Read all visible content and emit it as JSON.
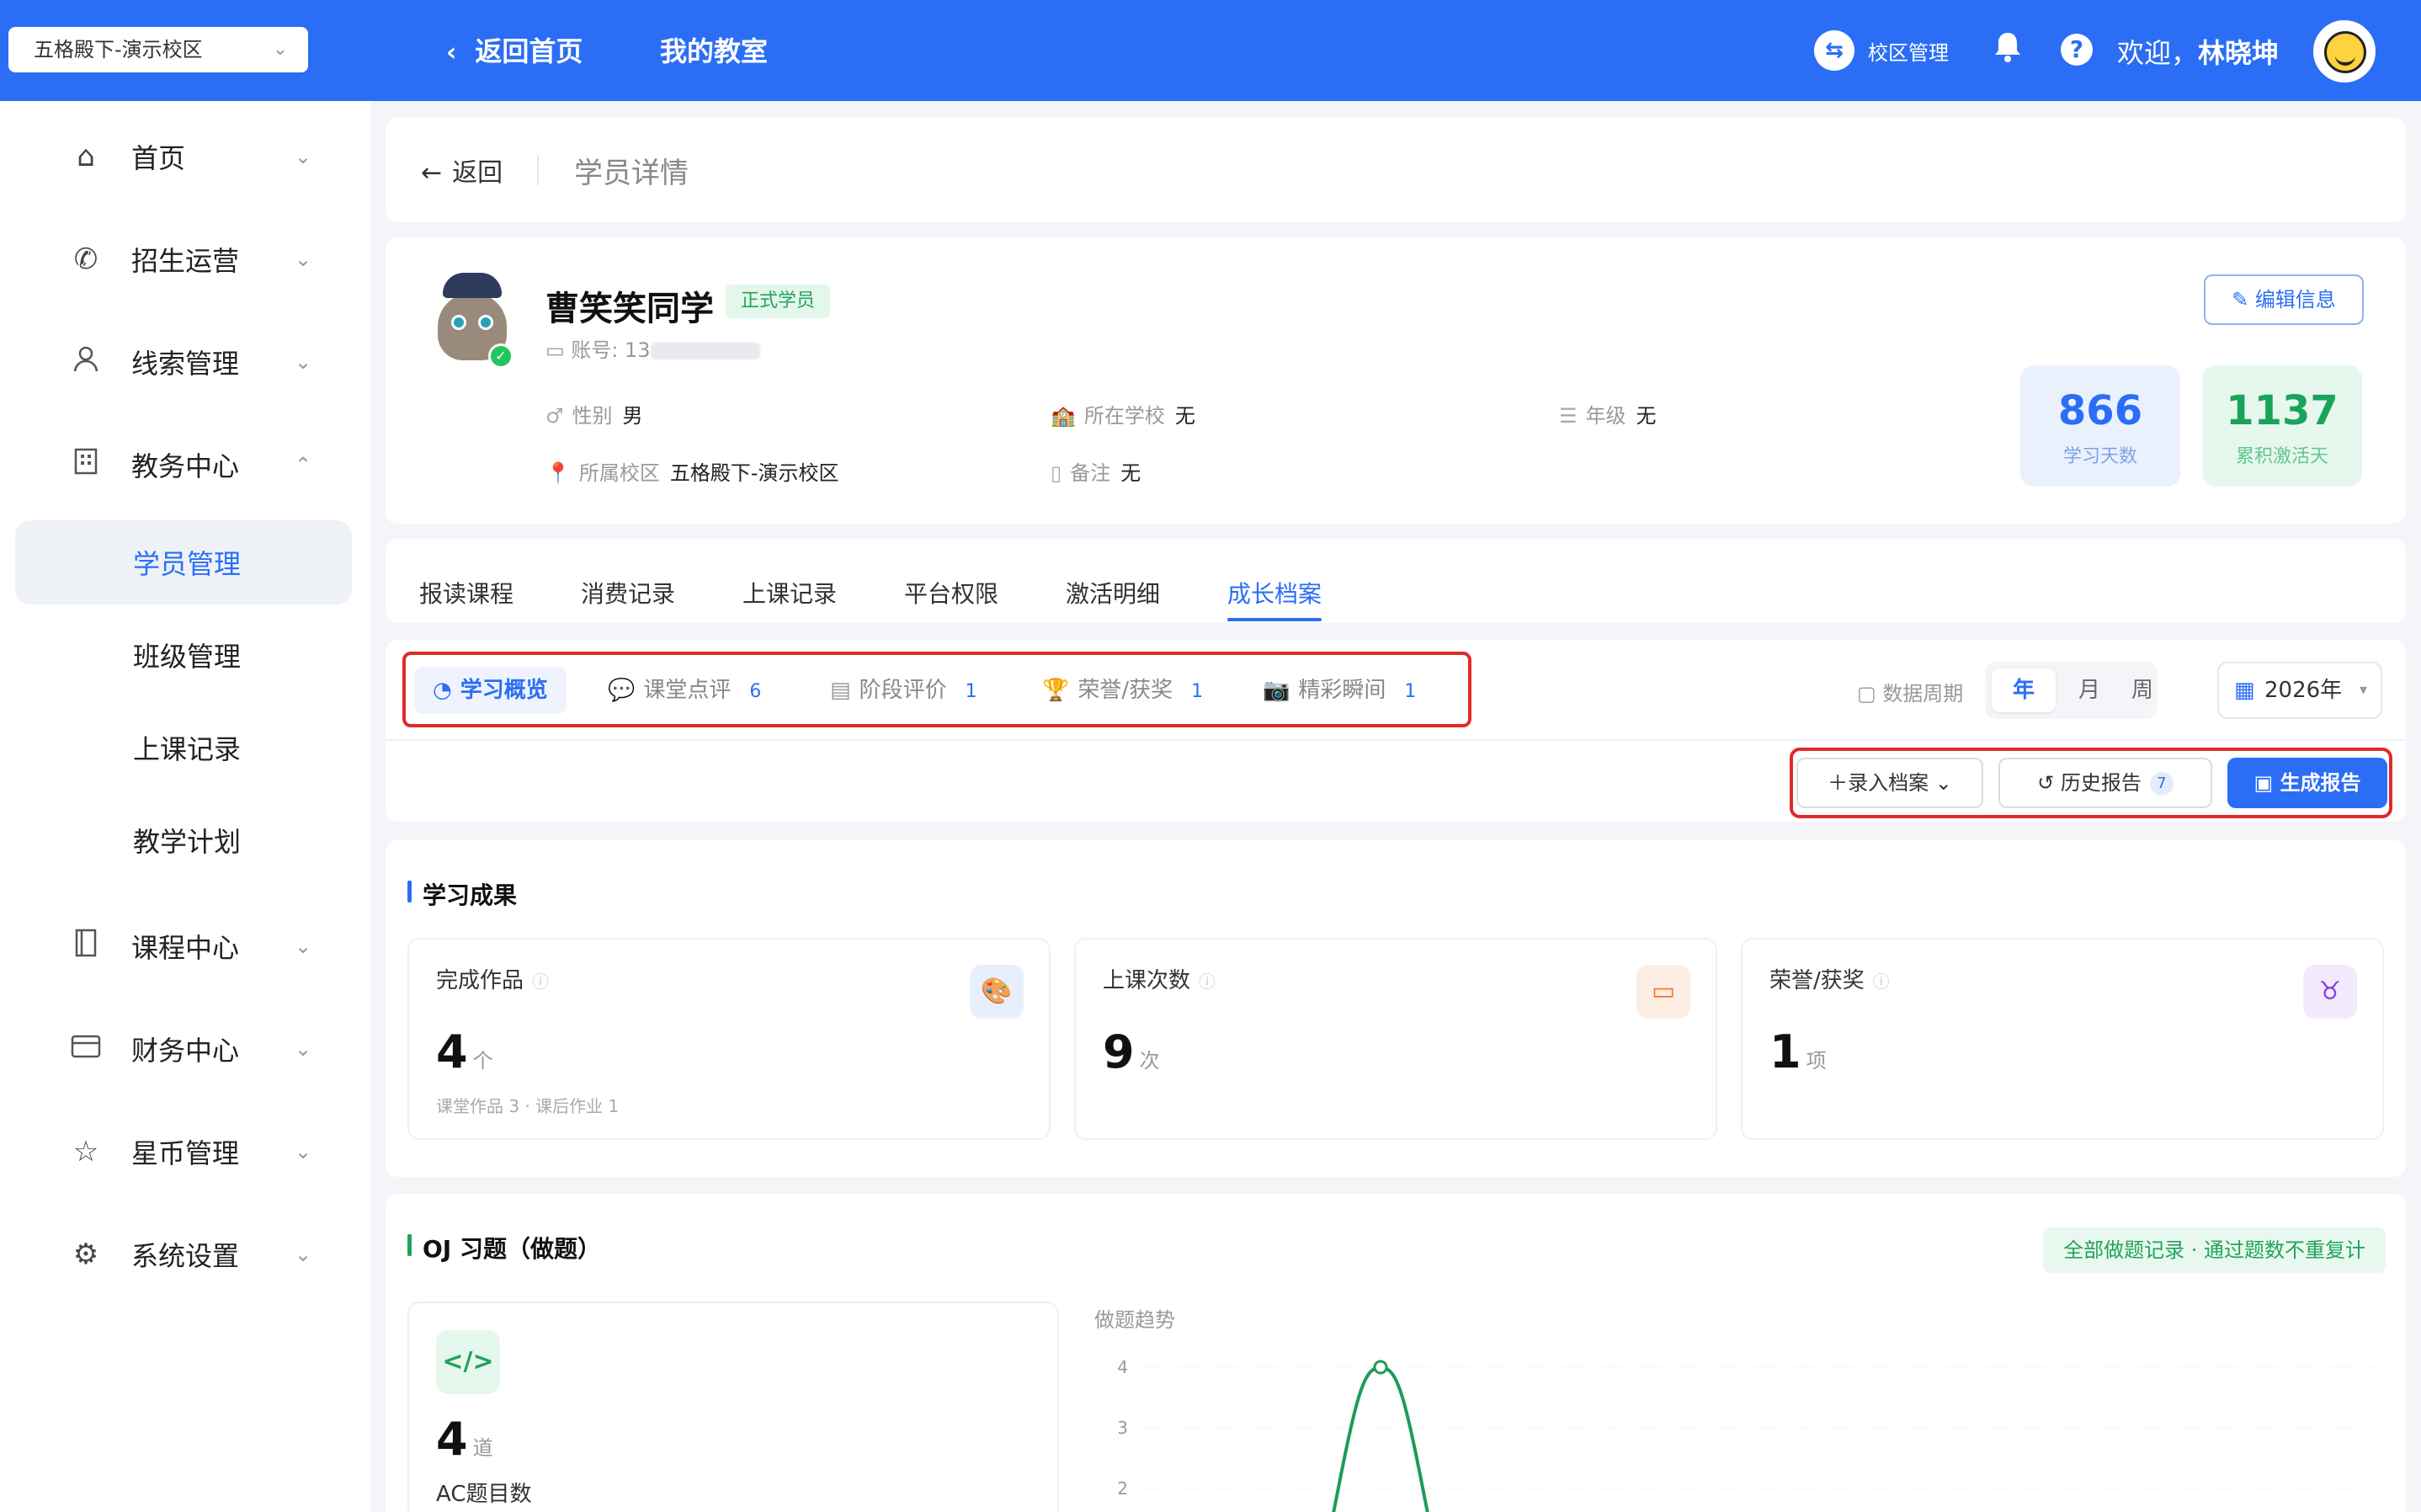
{
  "header": {
    "campus": "五格殿下-演示校区",
    "back_home": "返回首页",
    "my_classroom": "我的教室",
    "campus_mgmt": "校区管理",
    "welcome_prefix": "欢迎，",
    "user_name": "林晓坤"
  },
  "sidebar": {
    "items": [
      {
        "label": "首页",
        "icon": "home-icon"
      },
      {
        "label": "招生运营",
        "icon": "phone-icon"
      },
      {
        "label": "线索管理",
        "icon": "user-icon"
      },
      {
        "label": "教务中心",
        "icon": "building-icon"
      },
      {
        "label": "课程中心",
        "icon": "book-icon"
      },
      {
        "label": "财务中心",
        "icon": "card-icon"
      },
      {
        "label": "星币管理",
        "icon": "star-icon"
      },
      {
        "label": "系统设置",
        "icon": "gear-icon"
      }
    ],
    "sub_items": [
      "学员管理",
      "班级管理",
      "上课记录",
      "教学计划"
    ]
  },
  "breadcrumb": {
    "back": "返回",
    "title": "学员详情"
  },
  "student": {
    "name": "曹笑笑同学",
    "status": "正式学员",
    "account_label": "账号: 13",
    "gender_label": "性别",
    "gender": "男",
    "school_label": "所在学校",
    "school": "无",
    "grade_label": "年级",
    "grade": "无",
    "campus_label": "所属校区",
    "campus": "五格殿下-演示校区",
    "note_label": "备注",
    "note": "无",
    "edit_button": "编辑信息",
    "study_days": "866",
    "study_days_label": "学习天数",
    "active_days": "1137",
    "active_days_label": "累积激活天"
  },
  "tabs": [
    "报读课程",
    "消费记录",
    "上课记录",
    "平台权限",
    "激活明细",
    "成长档案"
  ],
  "subtabs": [
    {
      "label": "学习概览",
      "count": ""
    },
    {
      "label": "课堂点评",
      "count": "6"
    },
    {
      "label": "阶段评价",
      "count": "1"
    },
    {
      "label": "荣誉/获奖",
      "count": "1"
    },
    {
      "label": "精彩瞬间",
      "count": "1"
    }
  ],
  "period": {
    "label": "数据周期",
    "options": [
      "年",
      "月",
      "周"
    ],
    "selected_year": "2026年"
  },
  "actions": {
    "add": "录入档案",
    "history": "历史报告",
    "history_count": "7",
    "generate": "生成报告"
  },
  "results": {
    "title": "学习成果",
    "cards": [
      {
        "label": "完成作品",
        "value": "4",
        "unit": "个",
        "sub": "课堂作品 3 · 课后作业 1"
      },
      {
        "label": "上课次数",
        "value": "9",
        "unit": "次",
        "sub": ""
      },
      {
        "label": "荣誉/获奖",
        "value": "1",
        "unit": "项",
        "sub": ""
      }
    ]
  },
  "oj": {
    "title": "OJ 习题（做题）",
    "link": "全部做题记录 · 通过题数不重复计",
    "value": "4",
    "unit": "道",
    "label": "AC题目数",
    "trend_title": "做题趋势"
  },
  "chart_data": {
    "type": "line",
    "title": "做题趋势",
    "y_ticks": [
      "4",
      "3",
      "2"
    ],
    "ylim": [
      2,
      4
    ],
    "peak": 4
  }
}
